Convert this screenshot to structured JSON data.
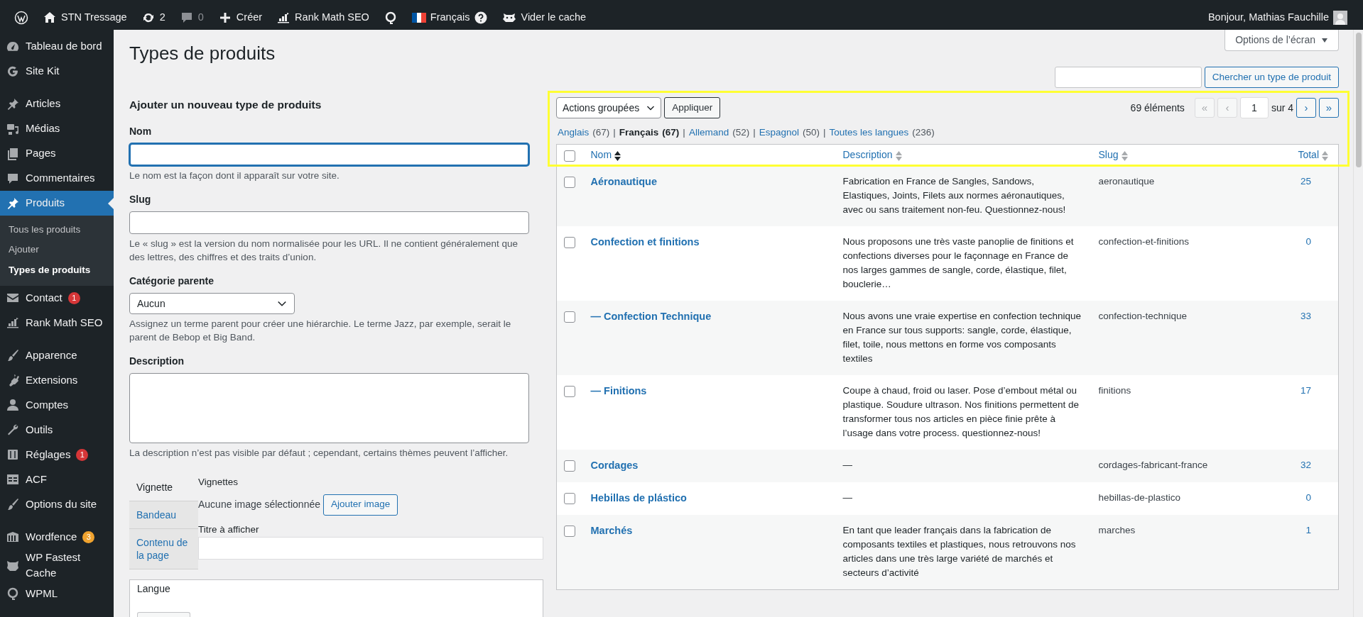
{
  "admin_bar": {
    "items": [
      {
        "kind": "icon",
        "disabled": false
      },
      {
        "kind": "link",
        "label": "STN Tressage",
        "disabled": false
      },
      {
        "kind": "link",
        "label": "2",
        "disabled": false
      },
      {
        "kind": "link",
        "label": "0",
        "disabled": true
      },
      {
        "kind": "link",
        "label": "Créer",
        "disabled": false
      },
      {
        "kind": "link",
        "label": "Rank Math SEO",
        "disabled": false
      },
      {
        "kind": "icon",
        "disabled": false
      },
      {
        "kind": "language",
        "label": "Français",
        "disabled": false
      },
      {
        "kind": "link",
        "label": "Vider le cache",
        "disabled": false
      }
    ],
    "greeting": "Bonjour, Mathias Fauchille"
  },
  "sidebar": {
    "groups": [
      [
        {
          "label": "Tableau de bord",
          "selected": false
        },
        {
          "label": "Site Kit",
          "selected": false
        }
      ],
      [
        {
          "label": "Articles",
          "selected": false
        },
        {
          "label": "Médias",
          "selected": false
        },
        {
          "label": "Pages",
          "selected": false
        },
        {
          "label": "Commentaires",
          "selected": false
        },
        {
          "label": "Produits",
          "selected": true,
          "children": [
            {
              "label": "Tous les produits",
              "selected": false
            },
            {
              "label": "Ajouter",
              "selected": false
            },
            {
              "label": "Types de produits",
              "selected": true
            }
          ]
        },
        {
          "label": "Contact",
          "selected": false,
          "badge": {
            "text": "1",
            "color": "#d63638"
          }
        },
        {
          "label": "Rank Math SEO",
          "selected": false
        }
      ],
      [
        {
          "label": "Apparence",
          "selected": false
        },
        {
          "label": "Extensions",
          "selected": false
        },
        {
          "label": "Comptes",
          "selected": false
        },
        {
          "label": "Outils",
          "selected": false
        },
        {
          "label": "Réglages",
          "selected": false,
          "badge": {
            "text": "1",
            "color": "#d63638"
          }
        },
        {
          "label": "ACF",
          "selected": false
        },
        {
          "label": "Options du site",
          "selected": false
        }
      ],
      [
        {
          "label": "Wordfence",
          "selected": false,
          "badge": {
            "text": "3",
            "color": "#f0a32f"
          }
        },
        {
          "label": "WP Fastest Cache",
          "selected": false
        },
        {
          "label": "WPML",
          "selected": false
        }
      ]
    ]
  },
  "page_title": "Types de produits",
  "screen_options": "Options de l’écran",
  "form": {
    "heading": "Ajouter un nouveau type de produits",
    "fields": [
      {
        "kind": "text",
        "label": "Nom",
        "focused": true,
        "help": "Le nom est la façon dont il apparaît sur votre site."
      },
      {
        "kind": "text",
        "label": "Slug",
        "focused": false,
        "help": "Le « slug » est la version du nom normalisée pour les URL. Il ne contient généralement que des lettres, des chiffres et des traits d’union."
      },
      {
        "kind": "select",
        "label": "Catégorie parente",
        "value": "Aucun",
        "focused": false,
        "help": "Assignez un terme parent pour créer une hiérarchie. Le terme Jazz, par exemple, serait le parent de Bebop et Big Band."
      },
      {
        "kind": "textarea",
        "label": "Description",
        "focused": false,
        "help": "La description n’est pas visible par défaut ; cependant, certains thèmes peuvent l’afficher."
      }
    ],
    "tabs": [
      {
        "label": "Vignette",
        "selected": true
      },
      {
        "label": "Bandeau",
        "selected": false
      },
      {
        "label": "Contenu de la page",
        "selected": false
      }
    ],
    "panel": {
      "label": "Vignettes",
      "image_status": "Aucune image sélectionnée",
      "button": "Ajouter image",
      "title_label": "Titre à afficher"
    },
    "language_box": {
      "label": "Langue"
    }
  },
  "list": {
    "search_button": "Chercher un type de produit",
    "bulk_action": "Actions groupées",
    "apply": "Appliquer",
    "count": "69 éléments",
    "pagination": {
      "first": {
        "label": "«",
        "disabled": true
      },
      "prev": {
        "label": "‹",
        "disabled": true
      },
      "page": "1",
      "of": "sur 4",
      "next": {
        "label": "›",
        "disabled": false
      },
      "last": {
        "label": "»",
        "disabled": false
      }
    },
    "languages": [
      {
        "label": "Anglais",
        "count": "(67)",
        "selected": false
      },
      {
        "label": "Français",
        "count": "(67)",
        "selected": true
      },
      {
        "label": "Allemand",
        "count": "(52)",
        "selected": false
      },
      {
        "label": "Espagnol",
        "count": "(50)",
        "selected": false
      },
      {
        "label": "Toutes les langues",
        "count": "(236)",
        "selected": false
      }
    ],
    "separator": "|",
    "select_all": {
      "checked": false
    },
    "columns": [
      {
        "label": "Nom",
        "sorted": true
      },
      {
        "label": "Description",
        "sorted": false
      },
      {
        "label": "Slug",
        "sorted": false
      },
      {
        "label": "Total",
        "sorted": false
      }
    ],
    "rows": [
      {
        "name": "Aéronautique",
        "description": "Fabrication en France de Sangles, Sandows, Elastiques, Joints, Filets aux normes aéronautiques, avec ou sans traitement non-feu. Questionnez-nous!",
        "slug": "aeronautique",
        "total": "25",
        "checked": false
      },
      {
        "name": "Confection et finitions",
        "description": "Nous proposons une très vaste panoplie de finitions et confections diverses pour le façonnage en France de nos larges gammes de sangle, corde, élastique, filet, bouclerie…",
        "slug": "confection-et-finitions",
        "total": "0",
        "checked": false
      },
      {
        "name": "— Confection Technique",
        "description": "Nous avons une vraie expertise en confection technique en France sur tous supports: sangle, corde, élastique, filet, toile, nous mettons en forme vos composants textiles",
        "slug": "confection-technique",
        "total": "33",
        "checked": false
      },
      {
        "name": "— Finitions",
        "description": "Coupe à chaud, froid ou laser. Pose d’embout métal ou plastique. Soudure ultrason. Nos finitions permettent de transformer tous nos articles en pièce finie prête à l’usage dans votre process. questionnez-nous!",
        "slug": "finitions",
        "total": "17",
        "checked": false
      },
      {
        "name": "Cordages",
        "description": "—",
        "slug": "cordages-fabricant-france",
        "total": "32",
        "checked": false
      },
      {
        "name": "Hebillas de plástico",
        "description": "—",
        "slug": "hebillas-de-plastico",
        "total": "0",
        "checked": false
      },
      {
        "name": "Marchés",
        "description": "En tant que leader français dans la fabrication de composants textiles et plastiques, nous retrouvons nos articles dans une très large variété de marchés et secteurs d’activité",
        "slug": "marches",
        "total": "1",
        "checked": false
      }
    ]
  }
}
